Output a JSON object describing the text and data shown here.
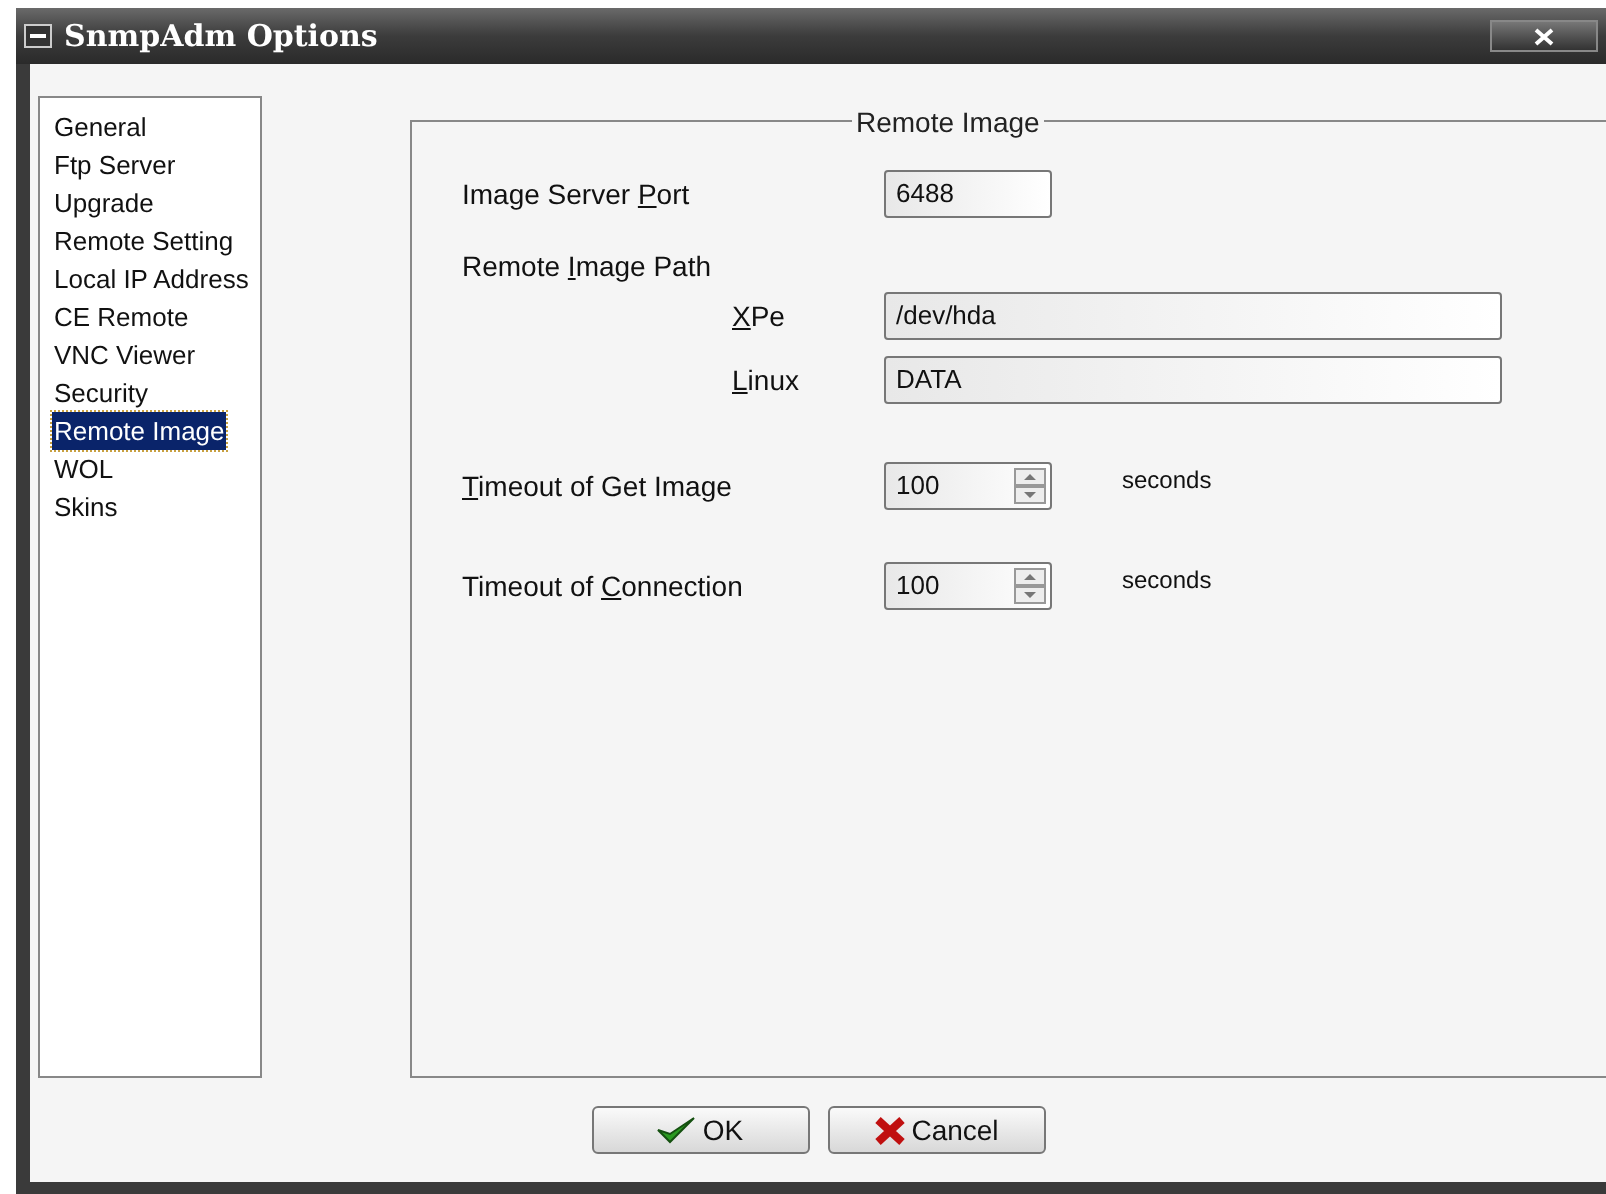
{
  "window": {
    "title": "SnmpAdm Options"
  },
  "sidebar": {
    "items": [
      {
        "label": "General",
        "selected": false
      },
      {
        "label": "Ftp Server",
        "selected": false
      },
      {
        "label": "Upgrade",
        "selected": false
      },
      {
        "label": "Remote Setting",
        "selected": false
      },
      {
        "label": "Local IP Address",
        "selected": false
      },
      {
        "label": "CE Remote",
        "selected": false
      },
      {
        "label": "VNC Viewer",
        "selected": false
      },
      {
        "label": "Security",
        "selected": false
      },
      {
        "label": "Remote Image",
        "selected": true
      },
      {
        "label": "WOL",
        "selected": false
      },
      {
        "label": "Skins",
        "selected": false
      }
    ]
  },
  "group": {
    "title": "Remote Image",
    "rows": [
      {
        "kind": "text",
        "label": {
          "before": "Image Server ",
          "key": "P",
          "after": "ort"
        },
        "value": "6488"
      },
      {
        "kind": "heading",
        "label": {
          "before": "Remote ",
          "key": "I",
          "after": "mage Path"
        }
      },
      {
        "kind": "path",
        "label": {
          "key": "X",
          "after": "Pe"
        },
        "value": "/dev/hda"
      },
      {
        "kind": "path",
        "label": {
          "key": "L",
          "after": "inux"
        },
        "value": "DATA"
      },
      {
        "kind": "spin",
        "label": {
          "key": "T",
          "after": "imeout of Get Image"
        },
        "value": "100",
        "unit": "seconds"
      },
      {
        "kind": "spin",
        "label": {
          "before": "Timeout of ",
          "key": "C",
          "after": "onnection"
        },
        "value": "100",
        "unit": "seconds"
      }
    ]
  },
  "buttons": [
    {
      "kind": "ok",
      "label": "OK"
    },
    {
      "kind": "cancel",
      "label": "Cancel"
    }
  ]
}
